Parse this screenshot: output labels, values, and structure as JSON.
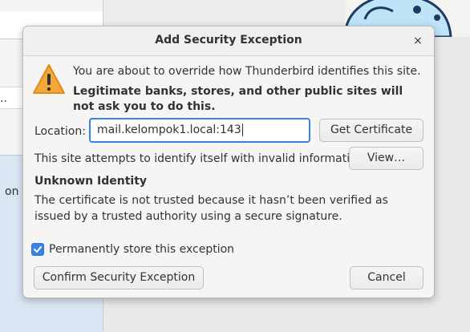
{
  "background": {
    "ellipsis": "..",
    "partial_text": "on"
  },
  "dialog": {
    "title": "Add Security Exception",
    "close_glyph": "×",
    "message_intro": "You are about to override how Thunderbird identifies this site.",
    "message_warning": "Legitimate banks, stores, and other public sites will not ask you to do this.",
    "location_label": "Location:",
    "location_value": "mail.kelompok1.local:143",
    "get_certificate_label": "Get Certificate",
    "site_attempt_text": "This site attempts to identify itself with invalid information.",
    "view_label": "View…",
    "unknown_identity_title": "Unknown Identity",
    "unknown_identity_desc": "The certificate is not trusted because it hasn’t been verified as issued by a trusted authority using a secure signature.",
    "permanent_store_label": "Permanently store this exception",
    "permanent_store_checked": true,
    "confirm_label": "Confirm Security Exception",
    "cancel_label": "Cancel"
  },
  "colors": {
    "accent": "#3584e4",
    "warning": "#f6a73b"
  }
}
